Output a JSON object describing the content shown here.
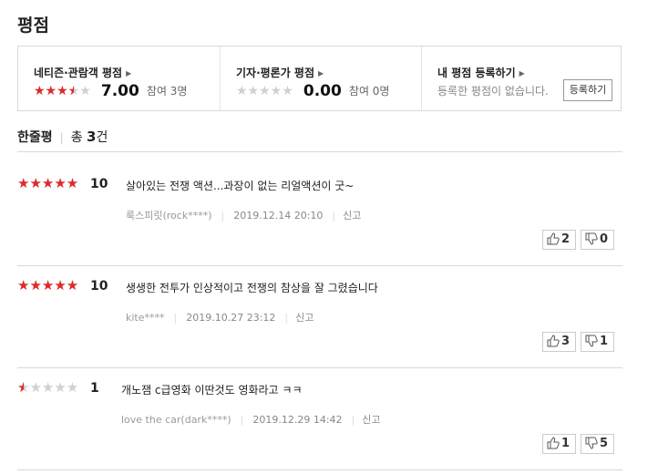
{
  "section_title": "평점",
  "netizen": {
    "heading": "네티즌·관람객 평점",
    "rating": 3.5,
    "score": "7.00",
    "participants": "참여 3명"
  },
  "critic": {
    "heading": "기자·평론가 평점",
    "rating": 0,
    "score": "0.00",
    "participants": "참여 0명"
  },
  "my_rating": {
    "heading": "내 평점 등록하기",
    "message": "등록한 평점이 없습니다.",
    "register_label": "등록하기"
  },
  "one_line": {
    "label": "한줄평",
    "count_prefix": "총",
    "count": "3",
    "count_suffix": "건"
  },
  "reviews": [
    {
      "rating": 5,
      "score": "10",
      "comment": "살아있는 전쟁 액션...과장이 없는 리얼액션이 굿~",
      "author": "룩스피릿(rock****)",
      "date": "2019.12.14 20:10",
      "report": "신고",
      "likes": "2",
      "dislikes": "0"
    },
    {
      "rating": 5,
      "score": "10",
      "comment": "생생한 전투가 인상적이고 전쟁의 참상을 잘 그렸습니다",
      "author": "kite****",
      "date": "2019.10.27 23:12",
      "report": "신고",
      "likes": "3",
      "dislikes": "1"
    },
    {
      "rating": 0.5,
      "score": "1",
      "comment": "개노잼 c급영화 이딴것도 영화라고 ㅋㅋ",
      "author": "love the car(dark****)",
      "date": "2019.12.29 14:42",
      "report": "신고",
      "likes": "1",
      "dislikes": "5"
    }
  ],
  "colors": {
    "star_on": "#e0282c",
    "star_off": "#d0d0d0",
    "border": "#d8d8d8"
  },
  "icons": {
    "like": "thumbs-up-icon",
    "dislike": "thumbs-down-icon",
    "arrow": "chevron-right-icon"
  }
}
